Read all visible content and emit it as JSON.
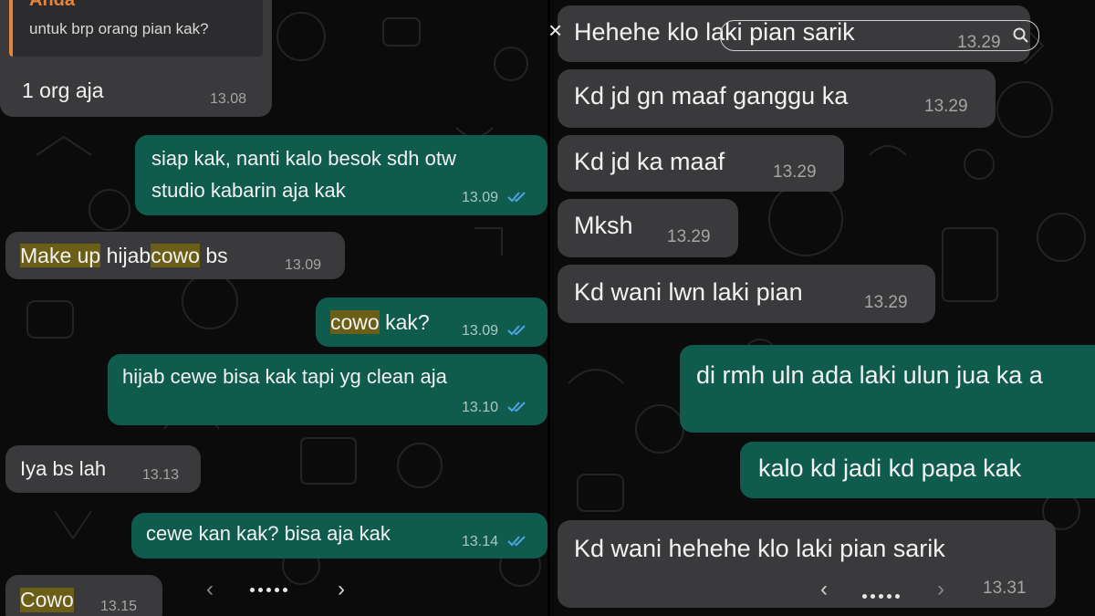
{
  "left_chat": {
    "quoted_reply": {
      "author": "Anda",
      "text": "untuk brp orang pian kak?",
      "reply_text": "1 org aja",
      "time": "13.08"
    },
    "messages": [
      {
        "lines": [
          "siap kak, nanti kalo besok sdh otw",
          "studio kabarin aja kak"
        ],
        "time": "13.09",
        "direction": "outgoing",
        "read": true
      },
      {
        "parts": [
          "Make up",
          "hijab",
          "cowo",
          "bs"
        ],
        "time": "13.09",
        "direction": "incoming"
      },
      {
        "parts": [
          "cowo",
          "kak?"
        ],
        "time": "13.09",
        "direction": "outgoing",
        "read": true
      },
      {
        "text": "hijab cewe bisa kak tapi yg clean aja",
        "time": "13.10",
        "direction": "outgoing",
        "read": true
      },
      {
        "text": "Iya bs lah",
        "time": "13.13",
        "direction": "incoming"
      },
      {
        "text": "cewe kan kak? bisa aja kak",
        "time": "13.14",
        "direction": "outgoing",
        "read": true
      },
      {
        "text": "Cowo",
        "time": "13.15",
        "direction": "incoming"
      }
    ],
    "pager": {
      "prev_icon": "‹",
      "next_icon": "›"
    }
  },
  "right_chat": {
    "search": {
      "close_icon": "×",
      "search_icon": "magnifier"
    },
    "messages": [
      {
        "text": "Hehehe klo laki pian sarik",
        "time": "13.29",
        "direction": "incoming"
      },
      {
        "text": "Kd jd gn maaf ganggu ka",
        "time": "13.29",
        "direction": "incoming"
      },
      {
        "text": "Kd jd ka maaf",
        "time": "13.29",
        "direction": "incoming"
      },
      {
        "text": "Mksh",
        "time": "13.29",
        "direction": "incoming"
      },
      {
        "text": "Kd wani lwn laki pian",
        "time": "13.29",
        "direction": "incoming"
      },
      {
        "text": "di rmh uln ada laki ulun jua ka a",
        "direction": "outgoing"
      },
      {
        "text": "kalo kd jadi kd papa kak",
        "direction": "outgoing"
      },
      {
        "text": "Kd wani hehehe klo laki pian sarik",
        "time": "13.31",
        "direction": "incoming"
      }
    ],
    "pager": {
      "prev_icon": "‹",
      "next_icon": "›"
    }
  },
  "colors": {
    "background": "#0b0b0b",
    "incoming_bubble": "#3a3a3c",
    "outgoing_bubble": "#0f5c4f",
    "highlight": "#6b5e16",
    "quote_accent": "#e8843a",
    "read_tick": "#4fa3e0"
  }
}
